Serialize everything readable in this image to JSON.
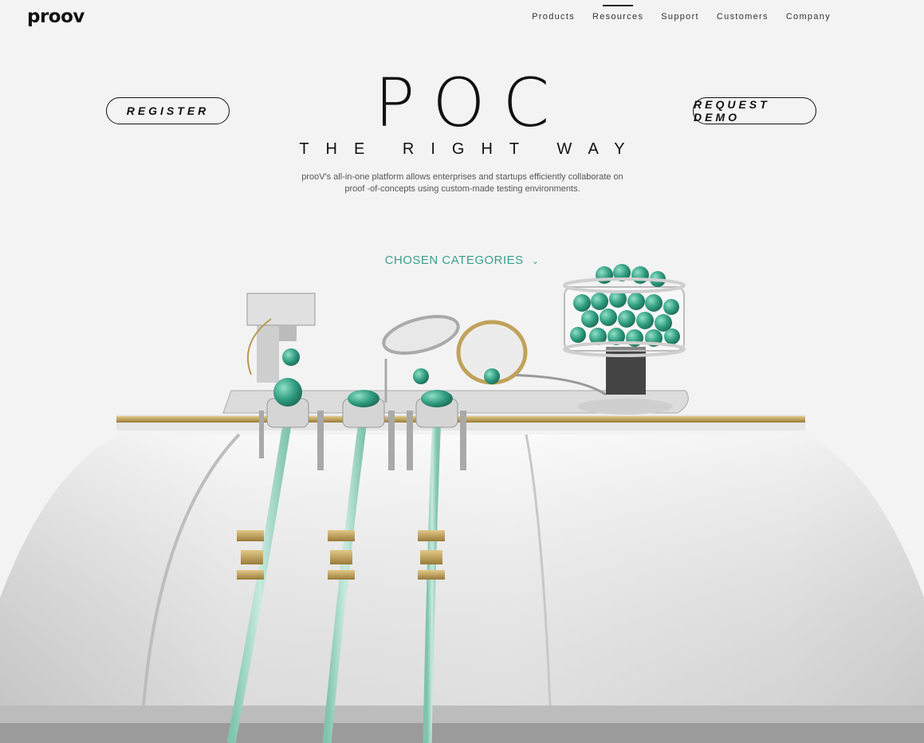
{
  "brand": {
    "logo": "proov"
  },
  "nav": {
    "items": [
      "Products",
      "Resources",
      "Support",
      "Customers",
      "Company"
    ],
    "active": "Resources"
  },
  "hero": {
    "register": "REGISTER",
    "demo": "REQUEST DEMO",
    "title": "POC",
    "subtitle": "THE RIGHT WAY",
    "description": "prooV's all-in-one platform allows enterprises and startups efficiently collaborate on proof -of-concepts using custom-made testing environments."
  },
  "categories": {
    "label": "CHOSEN CATEGORIES"
  },
  "colors": {
    "accent": "#3aa08a",
    "brass": "#b89a52",
    "metal": "#d8d8d8"
  }
}
